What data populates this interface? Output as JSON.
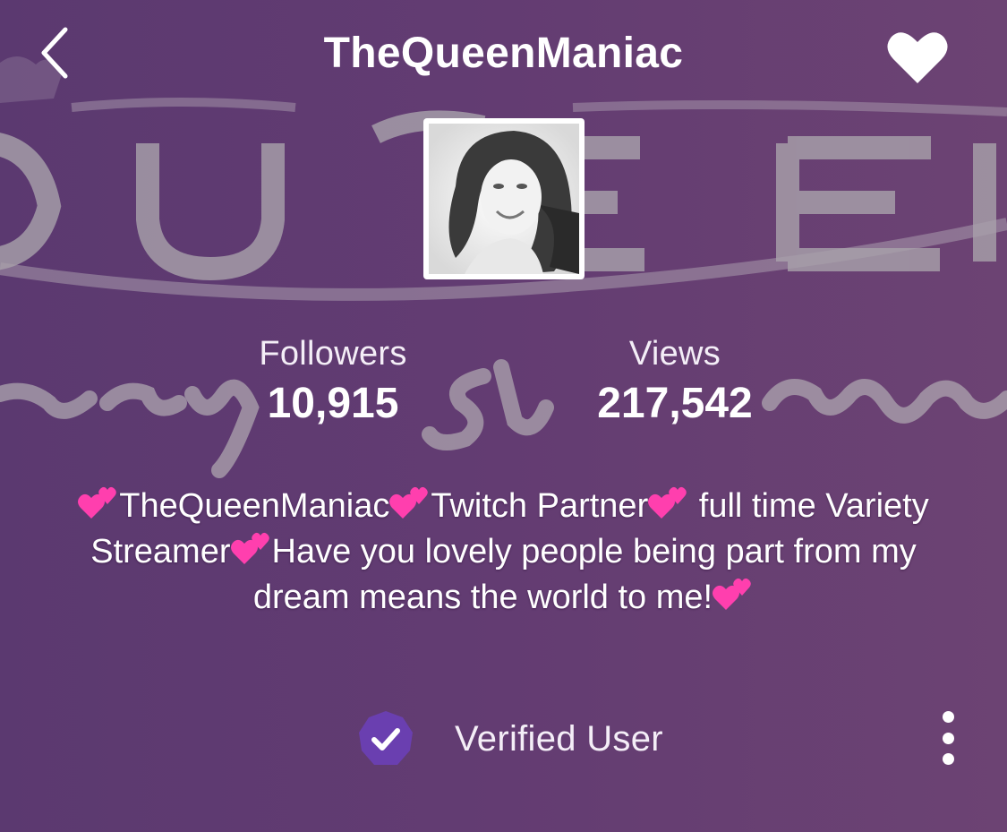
{
  "header": {
    "title": "TheQueenManiac",
    "back_icon": "chevron-left-icon",
    "favorite_icon": "heart-icon"
  },
  "profile": {
    "avatar": "profile-photo"
  },
  "stats": {
    "followers_label": "Followers",
    "followers_value": "10,915",
    "views_label": "Views",
    "views_value": "217,542"
  },
  "bio": {
    "segments": [
      "TheQueenManiac",
      "Twitch Partner",
      " full time Variety Streamer",
      "Have you lovely people being part from my dream means the world to me!"
    ],
    "emoji_icon": "two-hearts-icon"
  },
  "verification": {
    "label": "Verified User",
    "badge_icon": "verified-check-icon"
  },
  "menu": {
    "icon": "more-vertical-icon"
  },
  "colors": {
    "background": "#633c72",
    "badge": "#6a3fb0",
    "emoji_heart": "#ff3fae"
  }
}
